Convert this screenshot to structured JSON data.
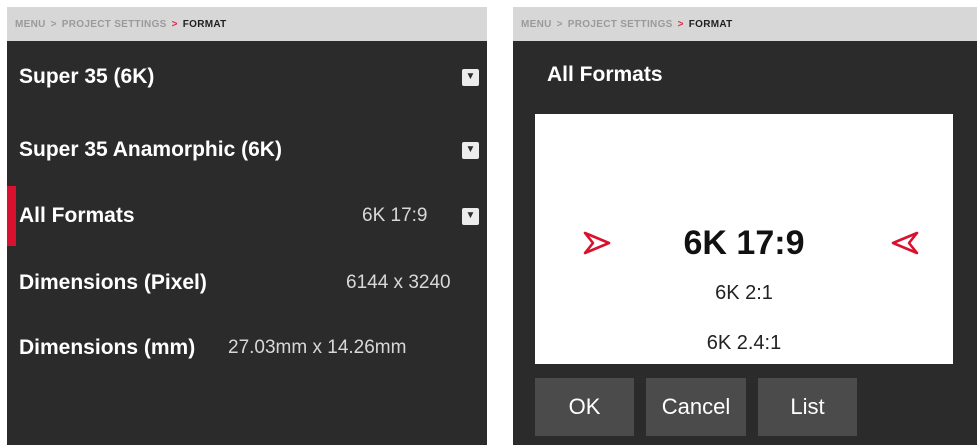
{
  "left_panel": {
    "breadcrumb": [
      "MENU",
      "PROJECT SETTINGS",
      "FORMAT"
    ],
    "rows": [
      {
        "label": "Super 35 (6K)",
        "value": "",
        "has_dropdown": true
      },
      {
        "label": "Super 35 Anamorphic (6K)",
        "value": "",
        "has_dropdown": true
      },
      {
        "label": "All Formats",
        "value": "6K 17:9",
        "has_dropdown": true,
        "selected": true
      },
      {
        "label": "Dimensions (Pixel)",
        "value": "6144 x 3240",
        "has_dropdown": false
      },
      {
        "label": "Dimensions (mm)",
        "value": "27.03mm x 14.26mm",
        "has_dropdown": false
      }
    ]
  },
  "right_panel": {
    "breadcrumb": [
      "MENU",
      "PROJECT SETTINGS",
      "FORMAT"
    ],
    "title": "All Formats",
    "picker": {
      "selected": "6K 17:9",
      "options_below": [
        "6K 2:1",
        "6K 2.4:1"
      ]
    },
    "buttons": [
      "OK",
      "Cancel",
      "List"
    ]
  },
  "colors": {
    "panel_bg": "#2b2b2b",
    "breadcrumb_bg": "#d7d7d7",
    "accent": "#d9102e",
    "button_bg": "#4b4b4b",
    "picker_bg": "#ffffff"
  },
  "icons": {
    "dropdown": "triangle-down-icon",
    "picker_left": "arrow-right-outline-icon",
    "picker_right": "arrow-left-outline-icon"
  }
}
